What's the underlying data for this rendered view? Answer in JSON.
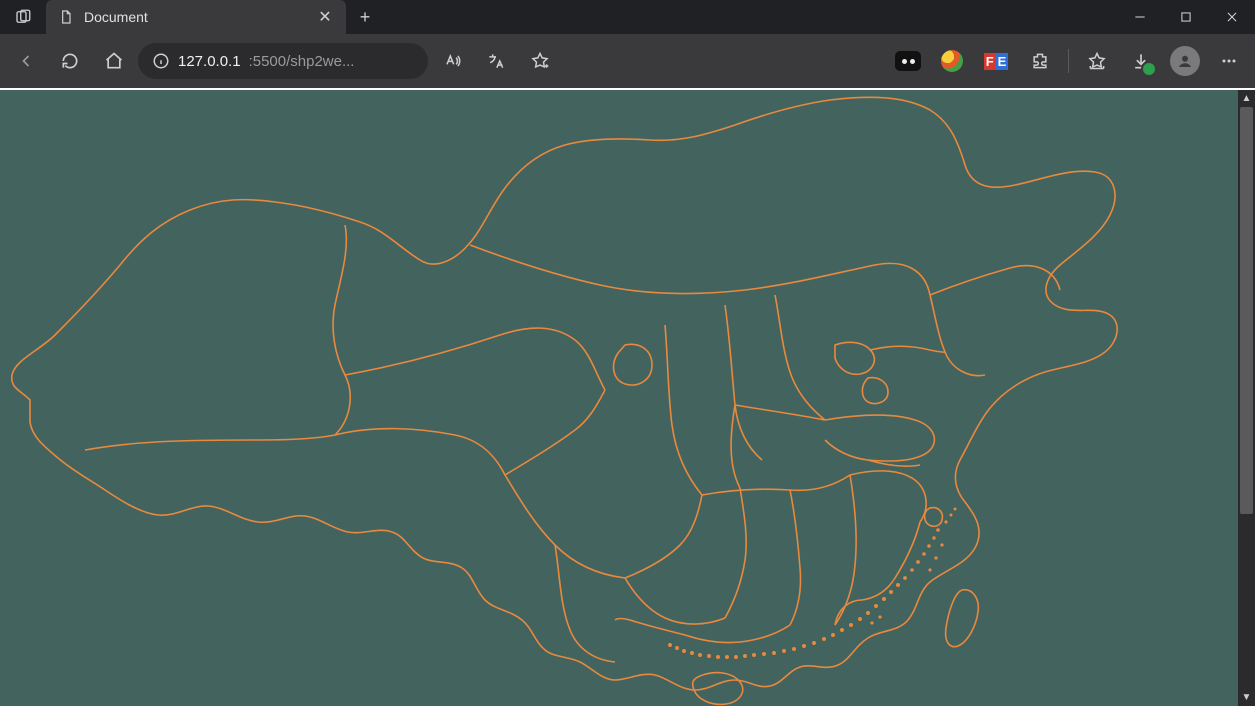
{
  "window": {
    "minimize_tip": "Minimize",
    "maximize_tip": "Maximize",
    "close_tip": "Close"
  },
  "tabs": {
    "active": {
      "title": "Document",
      "favicon": "page-icon"
    },
    "new_tab_tip": "New tab",
    "tab_actions_tip": "Tab actions"
  },
  "toolbar": {
    "back_tip": "Back",
    "refresh_tip": "Refresh",
    "home_tip": "Home",
    "site_info_tip": "View site information",
    "read_aloud_tip": "Read aloud",
    "translate_tip": "Translate",
    "favorite_tip": "Add this page to favorites",
    "extensions_tip": "Extensions",
    "collections_tip": "Favorites",
    "downloads_tip": "Downloads",
    "profile_tip": "Profile",
    "more_tip": "Settings and more"
  },
  "address": {
    "host": "127.0.0.1",
    "port_path": ":5500/shp2we..."
  },
  "extensions": {
    "dark_reader": "Dark Reader",
    "colorful": "Colorful extension",
    "fe_helper": "FE"
  },
  "content": {
    "description": "WebGL rendering of China province-boundary shapefile on teal canvas",
    "stroke_color": "#e8893e",
    "background_color": "#43635f"
  }
}
